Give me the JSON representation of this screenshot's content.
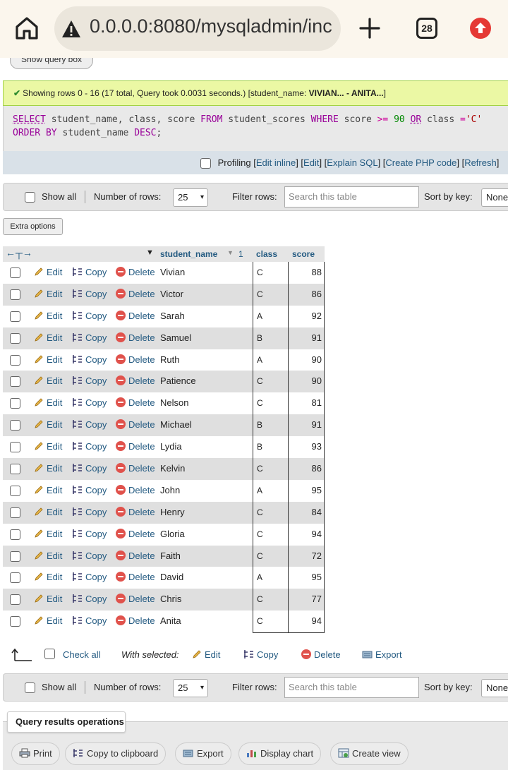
{
  "browser": {
    "url": "0.0.0.0:8080/mysqladmin/inc",
    "tab_count": "28"
  },
  "show_query_box_label": "Show query box",
  "status": {
    "message": "Showing rows 0 - 16 (17 total, Query took 0.0031 seconds.) [student_name: ",
    "range_bold": "VIVIAN... - ANITA...",
    "suffix": "]"
  },
  "sql": {
    "line1": {
      "k1": "SELECT",
      "t1": " student_name, class, score ",
      "k2": "FROM",
      "t2": " student_scores ",
      "k3": "WHERE",
      "t3": " score ",
      "op1": ">=",
      "t4": " ",
      "n1": "90",
      "t5": " ",
      "k4": "OR",
      "t6": " class ",
      "op2": "=",
      "s1": "'C'"
    },
    "line2": {
      "k1": "ORDER BY",
      "t1": " student_name ",
      "k2": "DESC",
      "t2": ";"
    }
  },
  "query_links": {
    "profiling": "Profiling",
    "edit_inline": "Edit inline",
    "edit": "Edit",
    "explain": "Explain SQL",
    "create_php": "Create PHP code",
    "refresh": "Refresh"
  },
  "nav": {
    "show_all": "Show all",
    "rows_label": "Number of rows:",
    "rows_value": "25",
    "filter_label": "Filter rows:",
    "filter_placeholder": "Search this table",
    "sort_label": "Sort by key:",
    "sort_value": "None"
  },
  "extra_options": "Extra options",
  "table": {
    "columns": {
      "student_name": "student_name",
      "sort_index": "1",
      "class": "class",
      "score": "score"
    },
    "actions": {
      "edit": "Edit",
      "copy": "Copy",
      "delete": "Delete"
    },
    "rows": [
      {
        "name": "Vivian",
        "class": "C",
        "score": "88"
      },
      {
        "name": "Victor",
        "class": "C",
        "score": "86"
      },
      {
        "name": "Sarah",
        "class": "A",
        "score": "92"
      },
      {
        "name": "Samuel",
        "class": "B",
        "score": "91"
      },
      {
        "name": "Ruth",
        "class": "A",
        "score": "90"
      },
      {
        "name": "Patience",
        "class": "C",
        "score": "90"
      },
      {
        "name": "Nelson",
        "class": "C",
        "score": "81"
      },
      {
        "name": "Michael",
        "class": "B",
        "score": "91"
      },
      {
        "name": "Lydia",
        "class": "B",
        "score": "93"
      },
      {
        "name": "Kelvin",
        "class": "C",
        "score": "86"
      },
      {
        "name": "John",
        "class": "A",
        "score": "95"
      },
      {
        "name": "Henry",
        "class": "C",
        "score": "84"
      },
      {
        "name": "Gloria",
        "class": "C",
        "score": "94"
      },
      {
        "name": "Faith",
        "class": "C",
        "score": "72"
      },
      {
        "name": "David",
        "class": "A",
        "score": "95"
      },
      {
        "name": "Chris",
        "class": "C",
        "score": "77"
      },
      {
        "name": "Anita",
        "class": "C",
        "score": "94"
      }
    ]
  },
  "bulk": {
    "check_all": "Check all",
    "with_selected": "With selected:",
    "edit": "Edit",
    "copy": "Copy",
    "delete": "Delete",
    "export": "Export"
  },
  "operations": {
    "title": "Query results operations",
    "print": "Print",
    "copy_clipboard": "Copy to clipboard",
    "export": "Export",
    "display_chart": "Display chart",
    "create_view": "Create view"
  }
}
